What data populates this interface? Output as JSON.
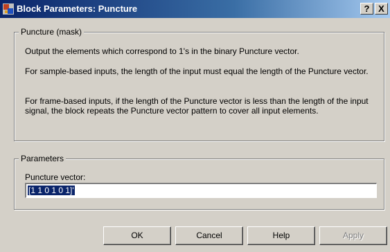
{
  "window": {
    "title": "Block Parameters: Puncture",
    "help_button": "?",
    "close_button": "X"
  },
  "mask_group": {
    "legend": "Puncture (mask)",
    "description": [
      "Output the elements which correspond to 1's in the binary Puncture vector.",
      "For sample-based inputs, the length of the input must equal the length of the Puncture vector.",
      "For frame-based inputs, if the length of the Puncture vector is less than the length of the input signal, the block repeats the Puncture vector pattern to cover all input elements."
    ]
  },
  "parameters_group": {
    "legend": "Parameters",
    "puncture_vector_label": "Puncture vector:",
    "puncture_vector_value": "[1 1 0 1 0 1]'"
  },
  "buttons": {
    "ok": "OK",
    "cancel": "Cancel",
    "help": "Help",
    "apply": "Apply"
  }
}
